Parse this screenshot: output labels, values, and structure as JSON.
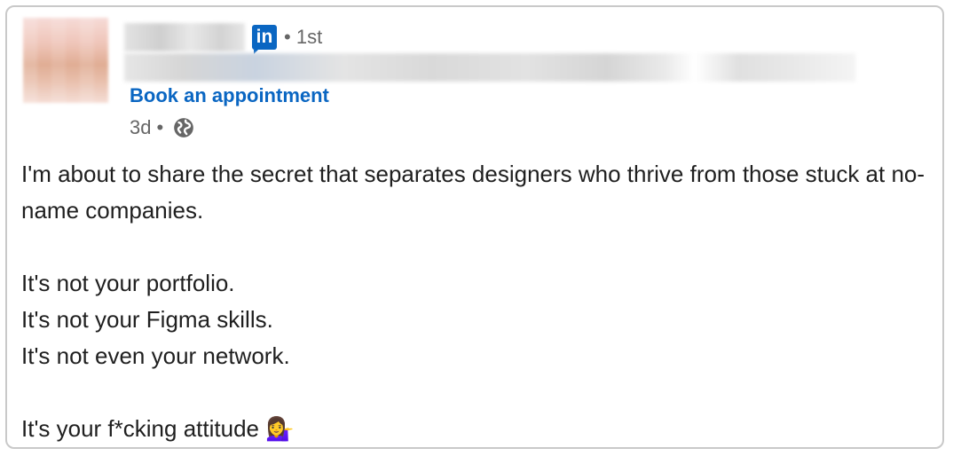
{
  "post": {
    "author": {
      "connection_degree": "1st",
      "cta_label": "Book an appointment"
    },
    "timestamp": "3d",
    "visibility_icon": "globe-icon",
    "network_badge": "in",
    "body": {
      "line1": "I'm about to share the secret that separates designers who thrive from those stuck at no-name companies.",
      "line2": "It's not your portfolio.",
      "line3": "It's not your Figma skills.",
      "line4": "It's not even your network.",
      "line5": "It's your f*cking attitude",
      "line5_emoji": "💁‍♀️"
    }
  },
  "colors": {
    "link": "#0a66c2",
    "muted": "#666666",
    "text": "#1f1f1f",
    "border": "#c9c9c9"
  }
}
